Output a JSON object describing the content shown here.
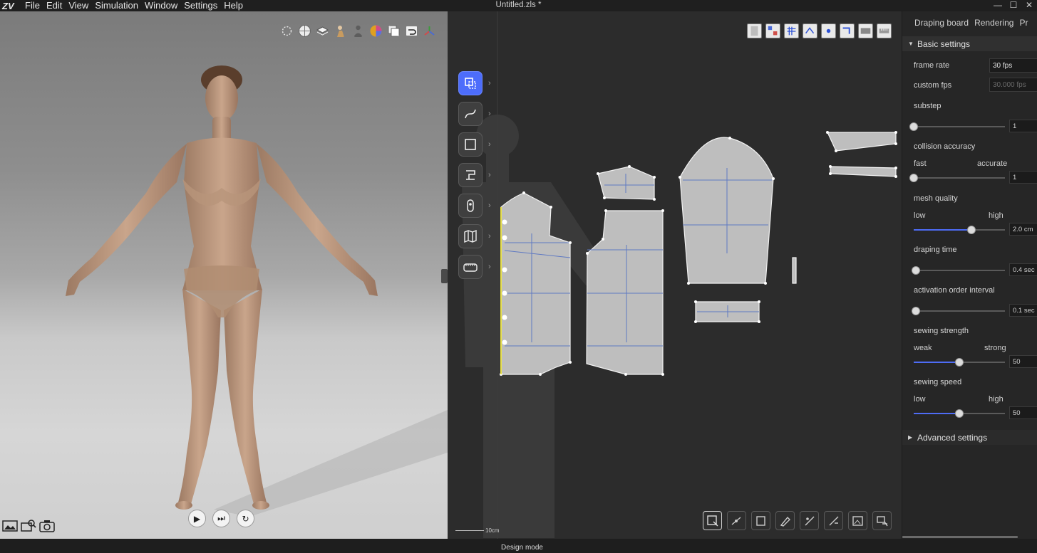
{
  "app": {
    "title": "Untitled.zls *",
    "logo_text": "ZV"
  },
  "menubar": {
    "items": [
      {
        "label": "File"
      },
      {
        "label": "Edit"
      },
      {
        "label": "View"
      },
      {
        "label": "Simulation"
      },
      {
        "label": "Window"
      },
      {
        "label": "Settings"
      },
      {
        "label": "Help"
      }
    ]
  },
  "window_controls": {
    "minimize": "—",
    "maximize": "☐",
    "close": "✕"
  },
  "viewport3d": {
    "toolbar_icons": [
      "lighting-icon",
      "sphere-icon",
      "layers-icon",
      "avatar-pose-icon",
      "avatar-icon",
      "color-wheel-icon",
      "copy-icon",
      "undo-icon",
      "gizmo-icon"
    ],
    "playback": {
      "play": "▶",
      "step": "⏭",
      "reset": "↻"
    },
    "camera_tools": [
      "image-icon",
      "zoom-image-icon",
      "camera-icon"
    ]
  },
  "viewport2d": {
    "top_toolbar_icons": [
      "texture-icon",
      "pattern-icon",
      "grid-visibility-icon",
      "seam-visibility-icon",
      "point-visibility-icon",
      "notch-visibility-icon",
      "fabric-icon",
      "ruler-icon"
    ],
    "left_tools": [
      {
        "name": "select-transform-tool",
        "icon": "select-transform-icon",
        "active": true
      },
      {
        "name": "curve-tool",
        "icon": "curve-icon",
        "active": false
      },
      {
        "name": "rectangle-tool",
        "icon": "rectangle-icon",
        "active": false
      },
      {
        "name": "sewing-tool",
        "icon": "sewing-machine-icon",
        "active": false
      },
      {
        "name": "pin-tool",
        "icon": "pin-icon",
        "active": false
      },
      {
        "name": "fold-tool",
        "icon": "fold-map-icon",
        "active": false
      },
      {
        "name": "measure-tool",
        "icon": "tape-measure-icon",
        "active": false
      }
    ],
    "bottom_tools": [
      "select-pattern-icon",
      "edit-point-icon",
      "edit-segment-icon",
      "add-point-icon",
      "cut-line-icon",
      "internal-line-icon",
      "add-image-icon",
      "sewing-edit-icon"
    ],
    "scale_label": "10cm"
  },
  "panel": {
    "tabs": [
      "Draping board",
      "Rendering",
      "Pr"
    ],
    "basic_settings": "Basic settings",
    "advanced_settings": "Advanced settings",
    "frame_rate": {
      "label": "frame rate",
      "value": "30 fps"
    },
    "custom_fps": {
      "label": "custom fps",
      "value": "30.000 fps"
    },
    "substep": {
      "label": "substep",
      "value": "1",
      "level": 0.0
    },
    "collision_accuracy": {
      "label": "collision accuracy",
      "left": "fast",
      "right": "accurate",
      "value": "1",
      "level": 0.0
    },
    "mesh_quality": {
      "label": "mesh quality",
      "left": "low",
      "right": "high",
      "value": "2.0 cm",
      "level": 0.63
    },
    "draping_time": {
      "label": "draping time",
      "value": "0.4 sec",
      "level": 0.02
    },
    "activation_order_interval": {
      "label": "activation order interval",
      "value": "0.1 sec",
      "level": 0.02
    },
    "sewing_strength": {
      "label": "sewing strength",
      "left": "weak",
      "right": "strong",
      "value": "50",
      "level": 0.5
    },
    "sewing_speed": {
      "label": "sewing speed",
      "left": "low",
      "right": "high",
      "value": "50",
      "level": 0.5
    }
  },
  "status": {
    "mode": "Design mode"
  },
  "colors": {
    "accent": "#4d6dfb",
    "panel_bg": "#262626",
    "canvas_bg": "#2c2c2c"
  }
}
